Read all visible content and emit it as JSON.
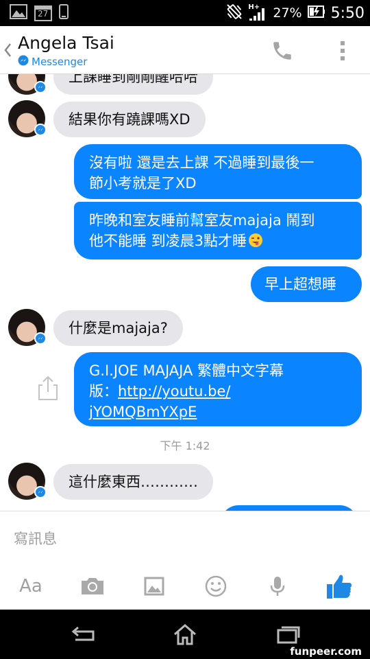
{
  "status_bar": {
    "calendar_day": "27",
    "battery_percent": "27%",
    "time": "5:50",
    "network": "H+"
  },
  "header": {
    "contact_name": "Angela Tsai",
    "subtitle": "Messenger"
  },
  "messages": [
    {
      "from": "them",
      "text": "上課睡到剛剛醒哈哈"
    },
    {
      "from": "them",
      "text": "結果你有蹺課嗎XD"
    },
    {
      "from": "me",
      "lines": [
        "沒有啦 還是去上課 不過睡到最後一",
        "節小考就是了XD"
      ]
    },
    {
      "from": "me",
      "lines": [
        "昨晚和室友睡前幫室友majaja 鬧到",
        "他不能睡 到凌晨3點才睡"
      ],
      "emoji": "tongue-wink-emoji"
    },
    {
      "from": "me",
      "text": "早上超想睡"
    },
    {
      "from": "them",
      "text": "什麼是majaja?"
    },
    {
      "from": "me",
      "lines": [
        "G.I.JOE MAJAJA 繁體中文字幕",
        "版："
      ],
      "link_part1": "http://youtu.be/",
      "link_part2": "jYOMQBmYXpE"
    },
    {
      "from": "them",
      "text": "這什麼東西…………"
    }
  ],
  "timestamp": "下午 1:42",
  "composer": {
    "placeholder": "寫訊息",
    "aa_label": "Aa"
  },
  "watermark": "funpeer.com",
  "colors": {
    "outgoing_bubble": "#0a84ff",
    "incoming_bubble": "#e5e5ea",
    "accent": "#1e88e5"
  }
}
